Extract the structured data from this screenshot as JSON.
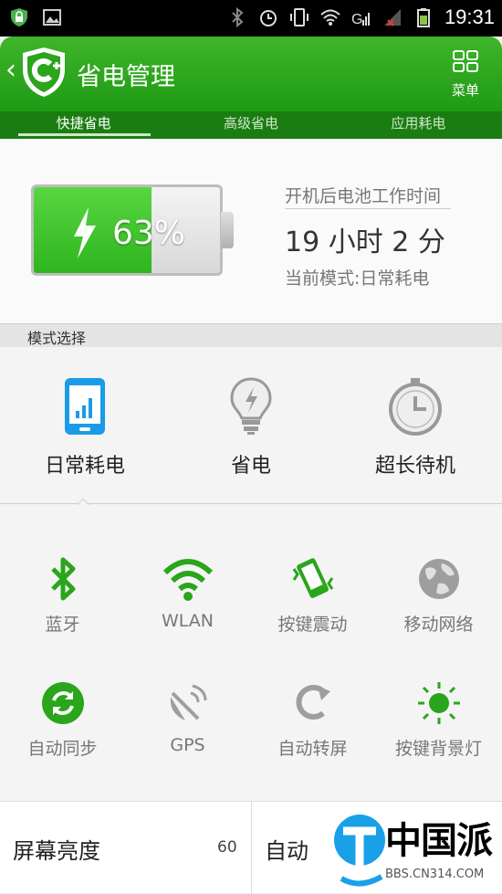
{
  "status_bar": {
    "time": "19:31",
    "icons": [
      "shield-lock-icon",
      "image-icon",
      "bluetooth-icon",
      "alarm-icon",
      "vibrate-icon",
      "wifi-icon",
      "signal-icon",
      "signal-2-icon",
      "battery-icon"
    ]
  },
  "app_bar": {
    "title": "省电管理",
    "menu_label": "菜单",
    "accent": "#22a015"
  },
  "tabs": [
    {
      "label": "快捷省电",
      "active": true
    },
    {
      "label": "高级省电",
      "active": false
    },
    {
      "label": "应用耗电",
      "active": false
    }
  ],
  "battery": {
    "percent_text": "63%",
    "level": 0.63,
    "info_label": "开机后电池工作时间",
    "uptime": "19 小时 2 分",
    "current_mode": "当前模式:日常耗电"
  },
  "mode_section": {
    "title": "模式选择",
    "modes": [
      {
        "label": "日常耗电",
        "icon": "phone-icon",
        "selected": true
      },
      {
        "label": "省电",
        "icon": "bulb-icon",
        "selected": false
      },
      {
        "label": "超长待机",
        "icon": "clock-icon",
        "selected": false
      }
    ]
  },
  "toggles": [
    {
      "label": "蓝牙",
      "icon": "bluetooth-icon",
      "on": true
    },
    {
      "label": "WLAN",
      "icon": "wifi-icon",
      "on": true
    },
    {
      "label": "按键震动",
      "icon": "vibrate-icon",
      "on": true
    },
    {
      "label": "移动网络",
      "icon": "globe-icon",
      "on": false
    },
    {
      "label": "自动同步",
      "icon": "sync-icon",
      "on": true
    },
    {
      "label": "GPS",
      "icon": "satellite-icon",
      "on": false
    },
    {
      "label": "自动转屏",
      "icon": "rotate-icon",
      "on": false
    },
    {
      "label": "按键背景灯",
      "icon": "sun-icon",
      "on": true
    }
  ],
  "bottom": {
    "brightness_label": "屏幕亮度",
    "brightness_value": "60",
    "auto_label": "自动"
  },
  "watermark": {
    "text": "中国派",
    "url": "BBS.CN314.COM"
  }
}
